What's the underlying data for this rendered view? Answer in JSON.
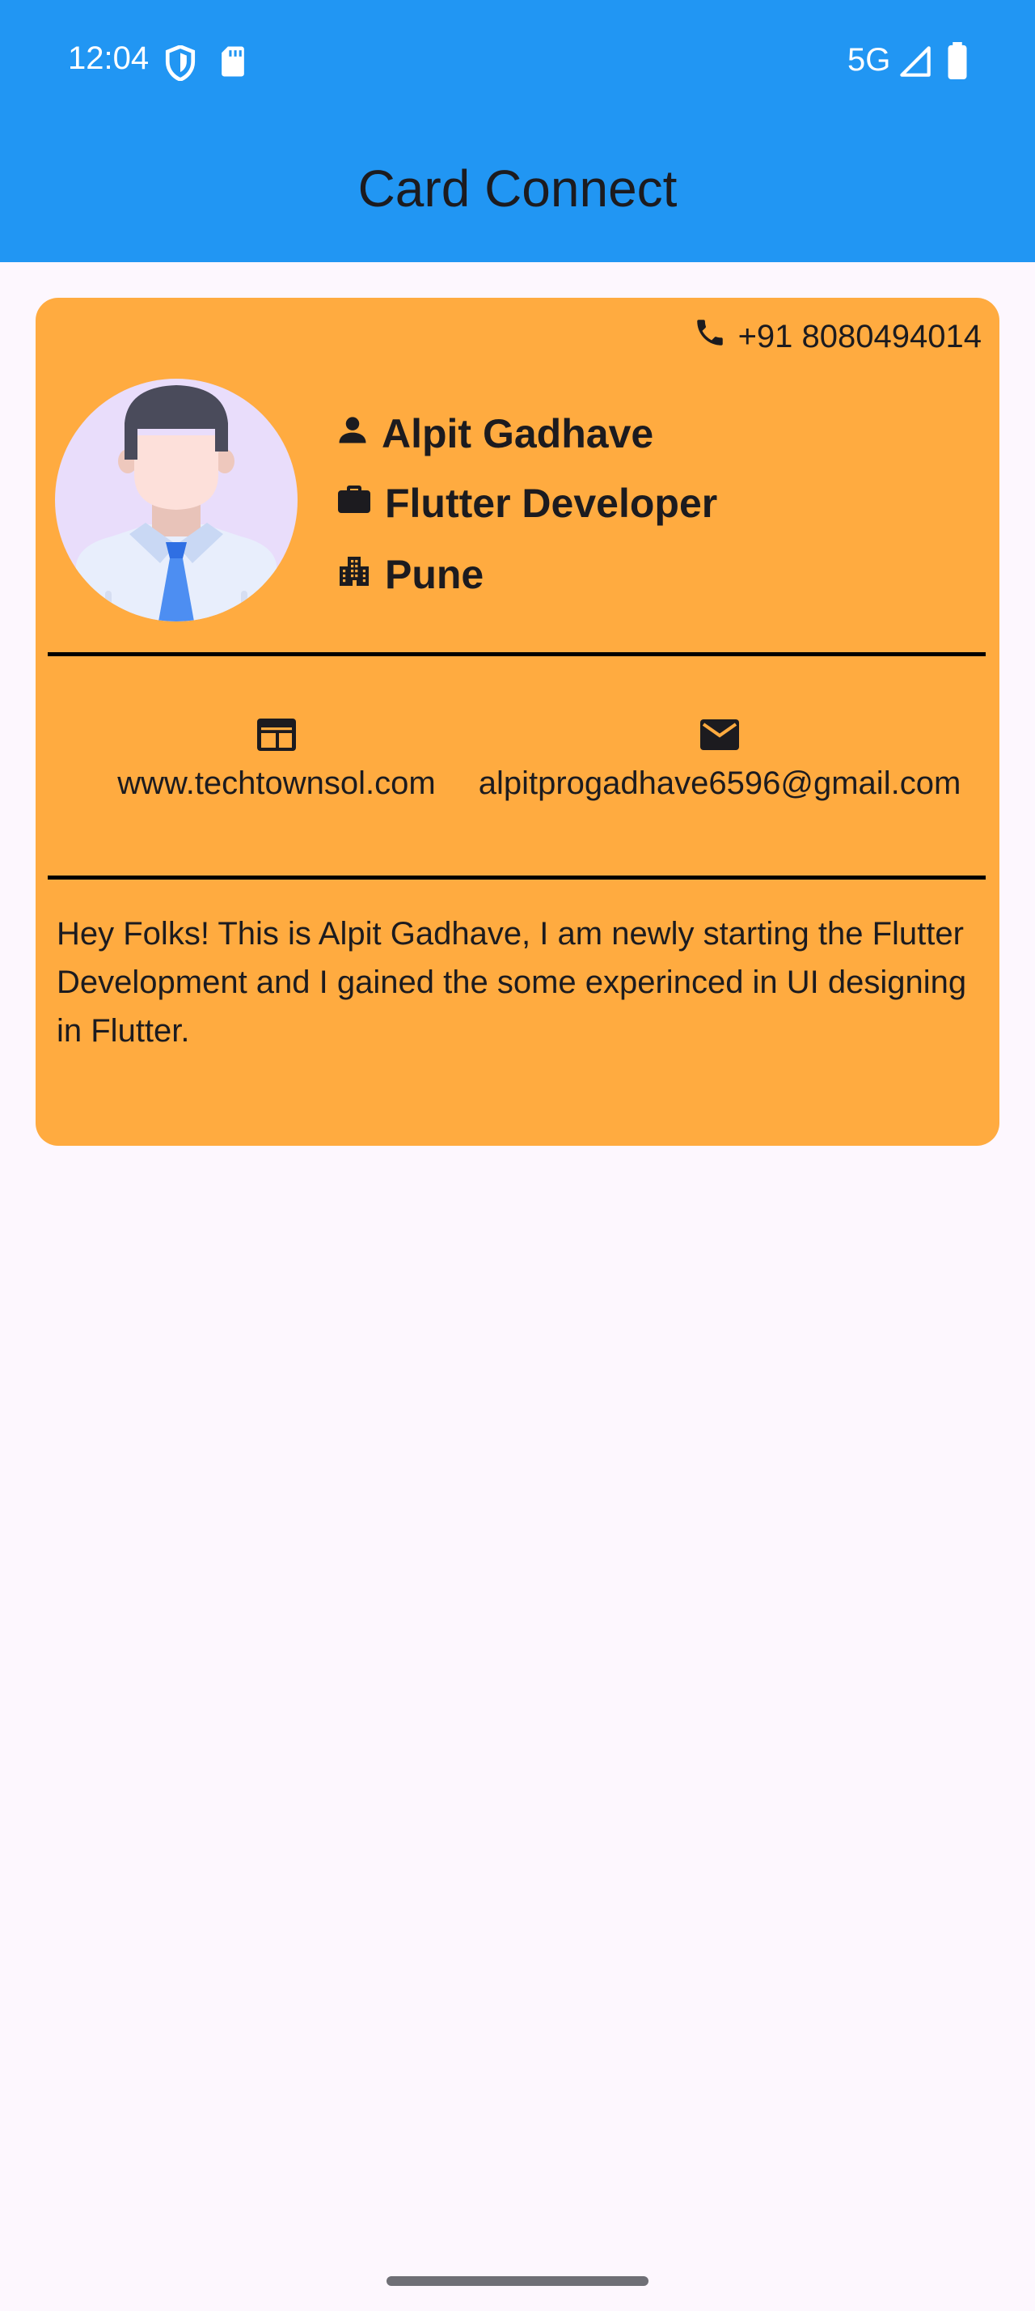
{
  "status_bar": {
    "time": "12:04",
    "network": "5G"
  },
  "app_bar": {
    "title": "Card Connect",
    "color": "#2196f3"
  },
  "card": {
    "background": "#ffab40",
    "phone": "+91 8080494014",
    "name": "Alpit Gadhave",
    "role": "Flutter Developer",
    "city": "Pune",
    "website": "www.techtownsol.com",
    "email": "alpitprogadhave6596@gmail.com",
    "about": "Hey Folks! This is Alpit Gadhave, I am newly starting the Flutter Development and I gained the some experinced in UI designing in Flutter."
  },
  "icons": {
    "phone": "phone-icon",
    "person": "person-icon",
    "work": "briefcase-icon",
    "city": "city-icon",
    "web": "web-icon",
    "email": "email-icon"
  }
}
